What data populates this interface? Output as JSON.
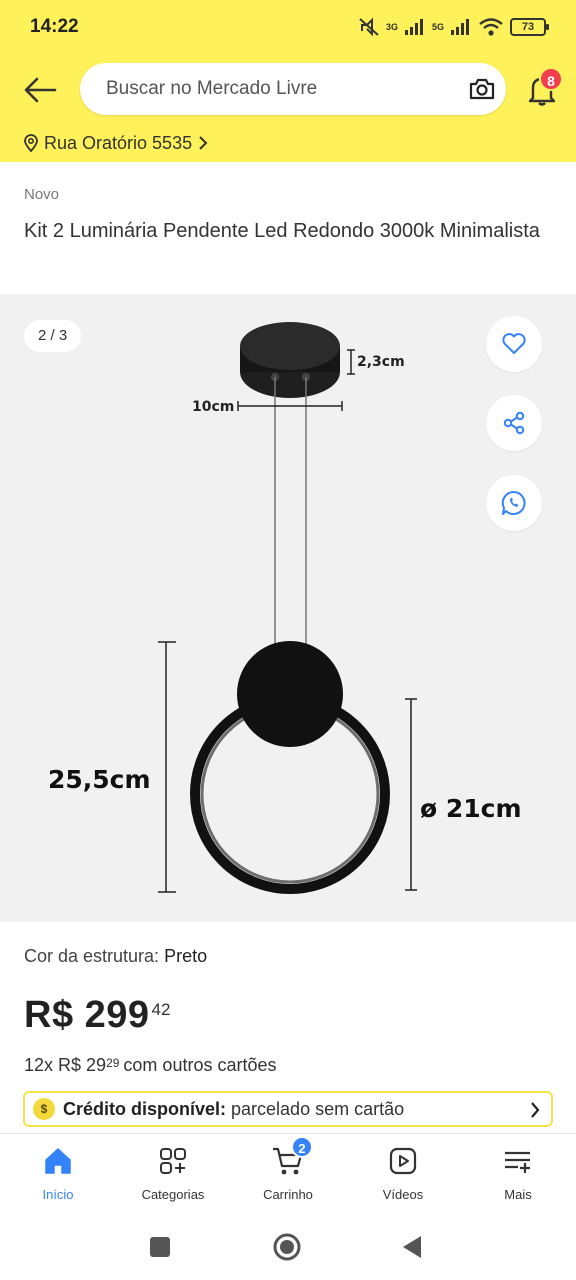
{
  "status_bar": {
    "time": "14:22",
    "net1": "3G",
    "net2": "5G",
    "battery": "73"
  },
  "header": {
    "search_placeholder": "Buscar no Mercado Livre",
    "notifications_count": "8",
    "address": "Rua Oratório 5535"
  },
  "product": {
    "condition": "Novo",
    "title": "Kit 2 Luminária Pendente Led Redondo 3000k Minimalista",
    "gallery": {
      "counter": "2 / 3",
      "dim_height_top": "2,3cm",
      "dim_width_top": "10cm",
      "dim_height": "25,5cm",
      "dim_diameter": "ø 21cm"
    },
    "color_label": "Cor da estrutura:",
    "color_value": "Preto",
    "price_currency_int": "R$ 299",
    "price_cents": "42",
    "installments_prefix": "12x R$ 29",
    "installments_cents": "29",
    "installments_suffix": "com outros cartões",
    "credit_strong": "Crédito disponível:",
    "credit_rest": "parcelado sem cartão"
  },
  "bottom_nav": {
    "items": [
      {
        "label": "Início",
        "icon": "home-icon"
      },
      {
        "label": "Categorias",
        "icon": "categories-icon"
      },
      {
        "label": "Carrinho",
        "icon": "cart-icon"
      },
      {
        "label": "Vídeos",
        "icon": "video-icon"
      },
      {
        "label": "Mais",
        "icon": "menu-plus-icon"
      }
    ],
    "cart_count": "2"
  },
  "colors": {
    "brand_yellow": "#fff159",
    "accent_blue": "#3483fa",
    "badge_red": "#f23d4f"
  }
}
